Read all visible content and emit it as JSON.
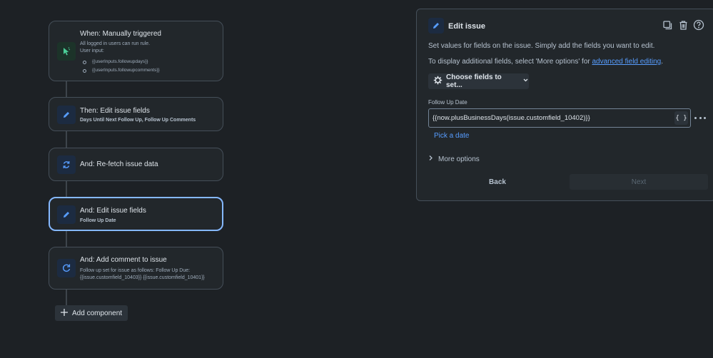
{
  "flow": {
    "trigger": {
      "title": "When: Manually triggered",
      "line1": "All logged in users can run rule.",
      "line2": "User input:",
      "inputs": [
        "{{userInputs.followupdays}}",
        "{{userInputs.followupcomments}}"
      ],
      "icon": "cursor-click-icon"
    },
    "step1": {
      "title": "Then: Edit issue fields",
      "sub_bold": "Days Until Next Follow Up, Follow Up Comments",
      "icon": "pencil-icon"
    },
    "step2": {
      "title": "And: Re-fetch issue data",
      "icon": "refresh-icon"
    },
    "step3": {
      "title": "And: Edit issue fields",
      "sub_bold": "Follow Up Date",
      "icon": "pencil-icon"
    },
    "step4": {
      "title": "And: Add comment to issue",
      "line1": "Follow up set for issue as follows: Follow Up Due:",
      "line2": "{{issue.customfield_10403}} {{issue.customfield_10401}}",
      "icon": "comment-refresh-icon"
    },
    "add_component": "Add component"
  },
  "panel": {
    "title": "Edit issue",
    "desc1": "Set values for fields on the issue. Simply add the fields you want to edit.",
    "desc2_pre": "To display additional fields, select 'More options' for ",
    "desc2_link": "advanced field editing",
    "desc2_post": ".",
    "choose_fields": "Choose fields to set...",
    "field_label": "Follow Up Date",
    "field_value": "{{now.plusBusinessDays(issue.customfield_10402)}}",
    "braces": "{ }",
    "pick_date": "Pick a date",
    "more_options": "More options",
    "back": "Back",
    "next": "Next"
  },
  "colors": {
    "background": "#1d2125",
    "card": "#22272b",
    "accent_blue": "#579dff",
    "selected_border": "#85b8ff",
    "trigger_green": "#4bce97"
  }
}
